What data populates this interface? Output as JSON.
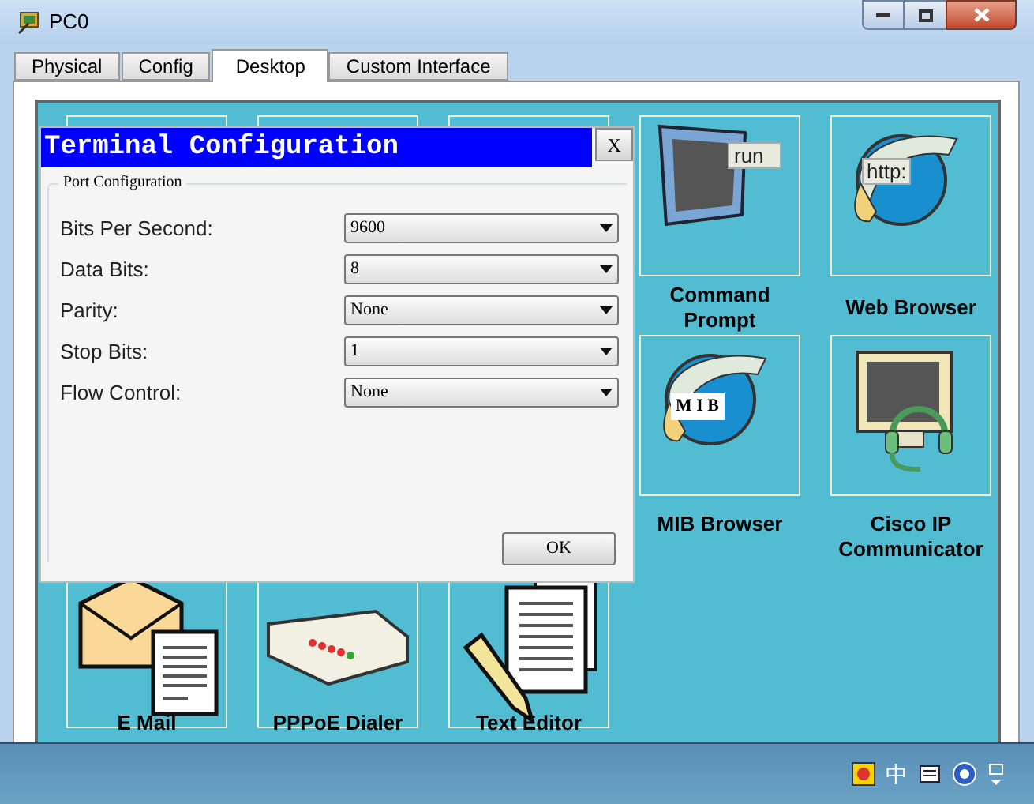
{
  "window": {
    "title": "PC0"
  },
  "tabs": [
    {
      "label": "Physical",
      "selected": false
    },
    {
      "label": "Config",
      "selected": false
    },
    {
      "label": "Desktop",
      "selected": true
    },
    {
      "label": "Custom Interface",
      "selected": false
    }
  ],
  "desktop": {
    "rows": [
      [
        {
          "kind": "covered"
        },
        {
          "kind": "covered"
        },
        {
          "kind": "covered"
        },
        {
          "kind": "prompt",
          "label": "Command Prompt",
          "badge": "run"
        },
        {
          "kind": "web",
          "label": "Web Browser",
          "badge": "http:"
        }
      ],
      [
        {
          "kind": "hidden"
        },
        {
          "kind": "hidden"
        },
        {
          "kind": "hidden"
        },
        {
          "kind": "mib",
          "label": "MIB Browser",
          "badge": "M I B"
        },
        {
          "kind": "phone",
          "label": "Cisco IP Communicator"
        }
      ],
      [
        {
          "kind": "mail",
          "label": "E Mail"
        },
        {
          "kind": "pppoe",
          "label": "PPPoE Dialer"
        },
        {
          "kind": "editor",
          "label": "Text Editor"
        }
      ]
    ]
  },
  "dialog": {
    "title": "Terminal Configuration",
    "close": "X",
    "group": "Port Configuration",
    "fields": [
      {
        "label": "Bits Per Second:",
        "value": "9600"
      },
      {
        "label": "Data Bits:",
        "value": "8"
      },
      {
        "label": "Parity:",
        "value": "None"
      },
      {
        "label": "Stop Bits:",
        "value": "1"
      },
      {
        "label": "Flow Control:",
        "value": "None"
      }
    ],
    "ok": "OK"
  },
  "taskbar": {
    "ime": "中"
  }
}
